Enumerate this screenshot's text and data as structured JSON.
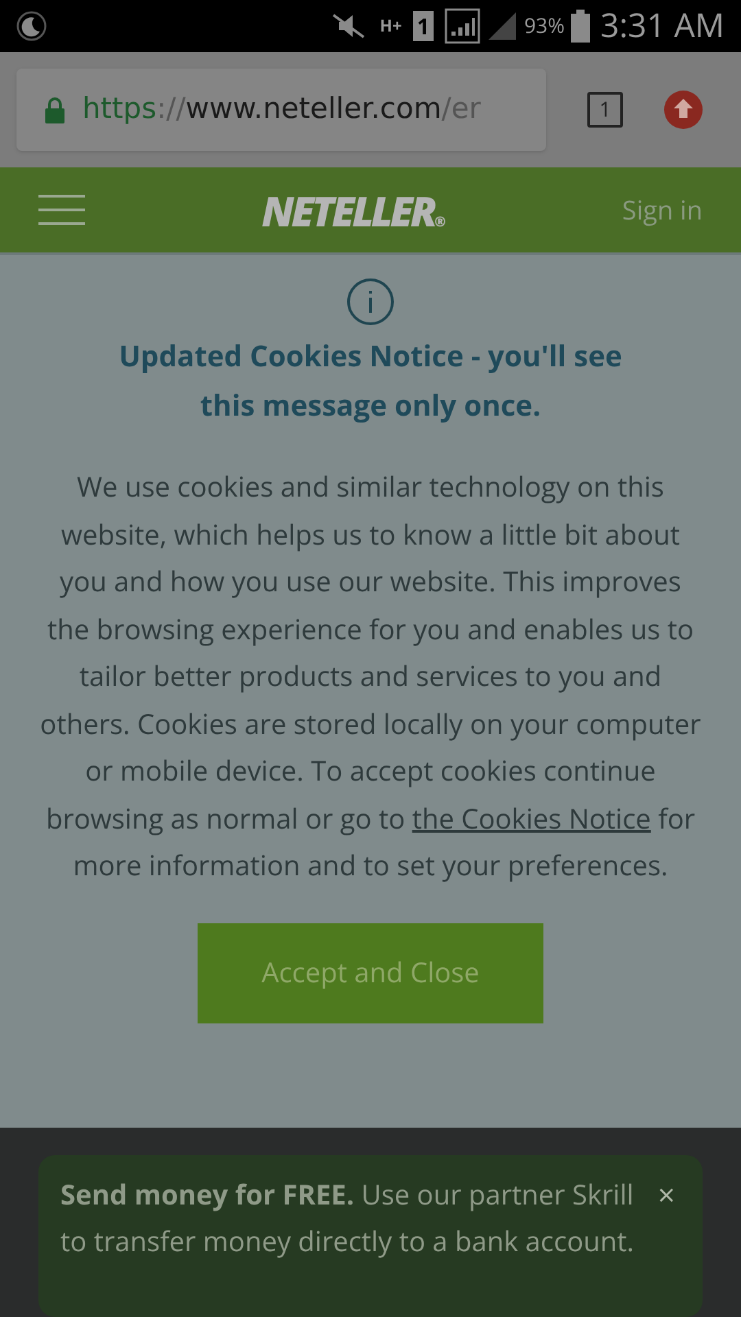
{
  "status_bar": {
    "sim": "1",
    "network": "H+",
    "battery": "93%",
    "time": "3:31 AM"
  },
  "browser": {
    "url": {
      "scheme": "https",
      "separator": "://",
      "host": "www.neteller.com",
      "path": "/er"
    },
    "tab_count": "1"
  },
  "header": {
    "logo": "NETELLER",
    "logo_mark": "®",
    "sign_in": "Sign in"
  },
  "notice": {
    "title": "Updated Cookies Notice - you'll see this message only once.",
    "text_before": "We use cookies and similar technology on this website, which helps us to know a little bit about you and how you use our website. This improves the browsing experience for you and enables us to tailor better products and services to you and others. Cookies are stored locally on your computer or mobile device. To accept cookies continue browsing as normal or go to",
    "link": "the Cookies Notice",
    "text_after": "for more information and to set your preferences.",
    "button": "Accept and Close"
  },
  "banner": {
    "text": "**Send money for FREE.** Use our partner Skrill to transfer money directly to a bank account.",
    "close": "×"
  }
}
